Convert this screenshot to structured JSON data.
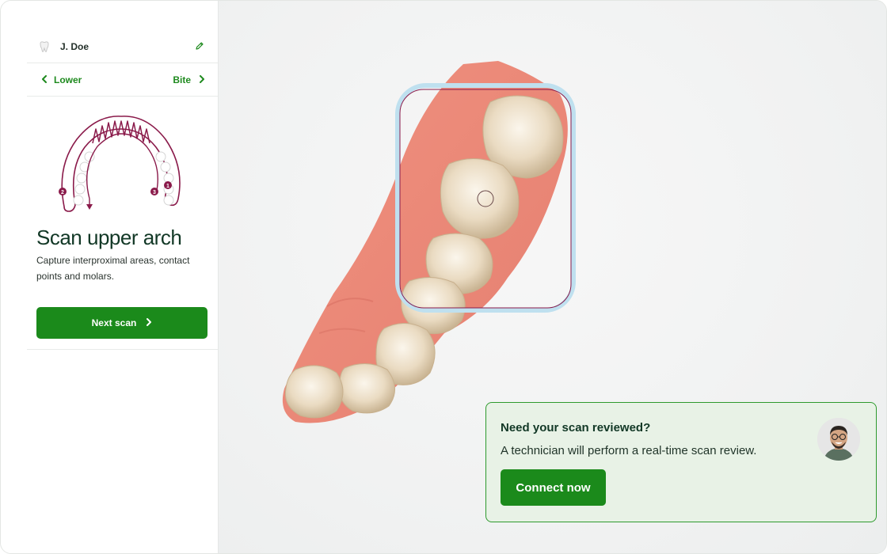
{
  "patient": {
    "name": "J. Doe",
    "avatar_icon": "tooth-icon",
    "edit_icon": "pencil-icon"
  },
  "navigation": {
    "prev_label": "Lower",
    "next_label": "Bite"
  },
  "arch_diagram": {
    "markers": [
      "1",
      "2",
      "3"
    ]
  },
  "scan_step": {
    "title": "Scan upper arch",
    "description": "Capture interproximal areas, contact points and molars.",
    "next_button": "Next scan"
  },
  "review_card": {
    "title": "Need your scan reviewed?",
    "text": "A technician will perform a real-time scan review.",
    "button": "Connect now"
  },
  "colors": {
    "accent": "#1b8a1b",
    "title": "#123826",
    "arch_marker": "#8a1a4a",
    "scan_frame": "#bfe0ef",
    "card_bg": "#e8f2e6"
  }
}
